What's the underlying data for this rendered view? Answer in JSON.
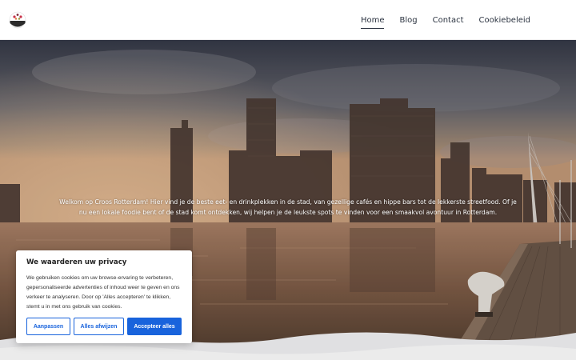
{
  "nav": {
    "items": [
      {
        "label": "Home",
        "active": true
      },
      {
        "label": "Blog",
        "active": false
      },
      {
        "label": "Contact",
        "active": false
      },
      {
        "label": "Cookiebeleid",
        "active": false
      }
    ]
  },
  "hero": {
    "text": "Welkom op Croos Rotterdam! Hier vind je de beste eet- en drinkplekken in de stad, van gezellige cafés en hippe bars tot de lekkerste streetfood. Of je nu een lokale foodie bent of de stad komt ontdekken, wij helpen je de leukste spots te vinden voor een smaakvol avontuur in Rotterdam."
  },
  "cookie": {
    "title": "We waarderen uw privacy",
    "body": "We gebruiken cookies om uw browse-ervaring te verbeteren, gepersonaliseerde advertenties of inhoud weer te geven en ons verkeer te analyseren. Door op 'Alles accepteren' te klikken, stemt u in met ons gebruik van cookies.",
    "customize_label": "Aanpassen",
    "reject_label": "Alles afwijzen",
    "accept_label": "Accepteer alles"
  },
  "colors": {
    "accent": "#1863dc",
    "nav_text": "#2b3340"
  },
  "icons": {
    "logo": "croos-logo-icon"
  }
}
